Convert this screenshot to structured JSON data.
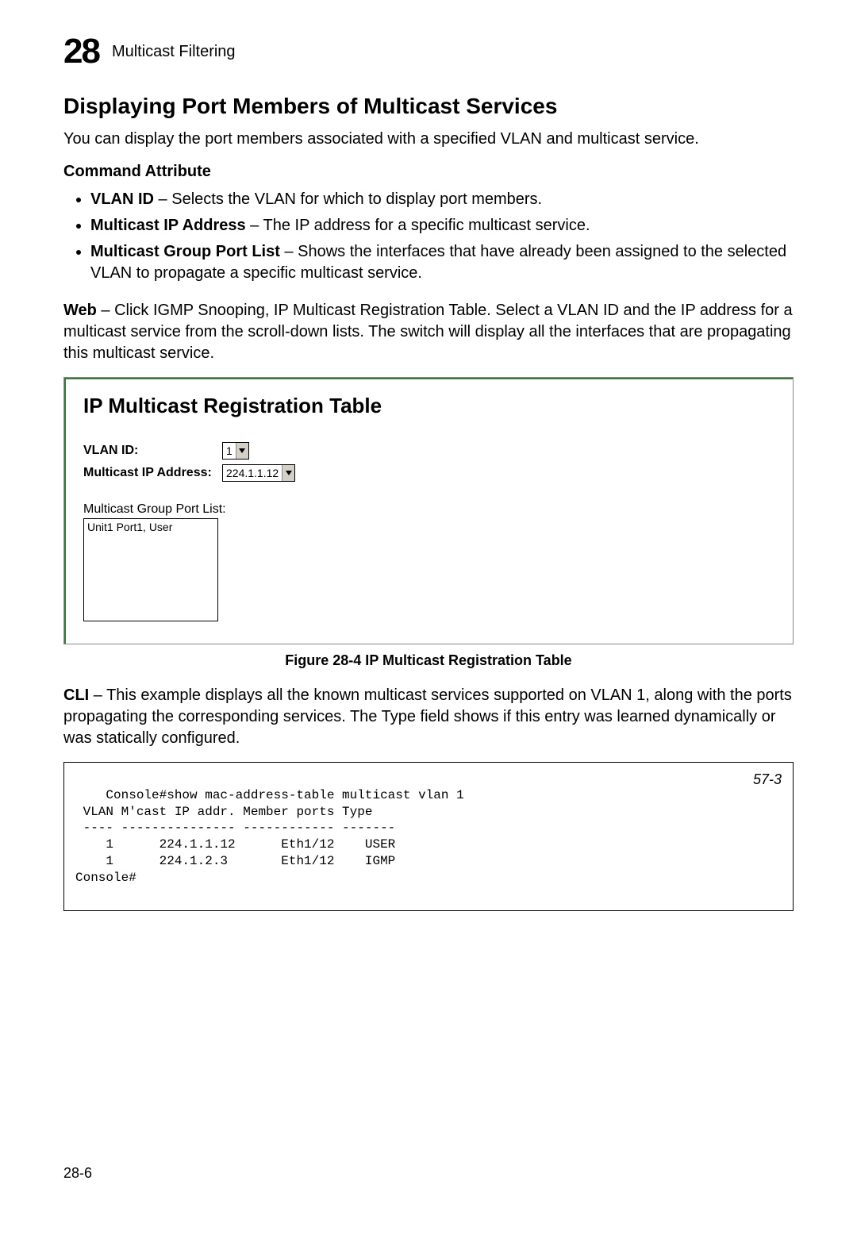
{
  "chapter": {
    "number": "28",
    "title": "Multicast Filtering"
  },
  "section_heading": "Displaying Port Members of Multicast Services",
  "intro": "You can display the port members associated with a specified VLAN and multicast service.",
  "cmd_attr_heading": "Command Attribute",
  "bullets": [
    {
      "term": "VLAN ID",
      "desc": " – Selects the VLAN for which to display port members."
    },
    {
      "term": "Multicast IP Address",
      "desc": " – The IP address for a specific multicast service."
    },
    {
      "term": "Multicast Group Port List",
      "desc": " – Shows the interfaces that have already been assigned to the selected VLAN to propagate a specific multicast service."
    }
  ],
  "web_lead": "Web",
  "web_desc": " – Click IGMP Snooping, IP Multicast Registration Table. Select a VLAN ID and the IP address for a multicast service from the scroll-down lists. The switch will display all the interfaces that are propagating this multicast service.",
  "panel": {
    "title": "IP Multicast Registration Table",
    "vlan_label": "VLAN ID:",
    "vlan_value": "1",
    "ip_label": "Multicast IP Address:",
    "ip_value": "224.1.1.12",
    "port_list_label": "Multicast Group Port List:",
    "port_list_items": [
      "Unit1 Port1, User"
    ]
  },
  "figure_caption": "Figure 28-4  IP Multicast Registration Table",
  "cli_lead": "CLI",
  "cli_desc": " – This example displays all the known multicast services supported on VLAN 1, along with the ports propagating the corresponding services. The Type field shows if this entry was learned dynamically or was statically configured.",
  "cli_ref": "57-3",
  "cli_text": "Console#show mac-address-table multicast vlan 1\n VLAN M'cast IP addr. Member ports Type\n ---- --------------- ------------ -------\n    1      224.1.1.12      Eth1/12    USER\n    1      224.1.2.3       Eth1/12    IGMP\nConsole#",
  "page_number": "28-6"
}
